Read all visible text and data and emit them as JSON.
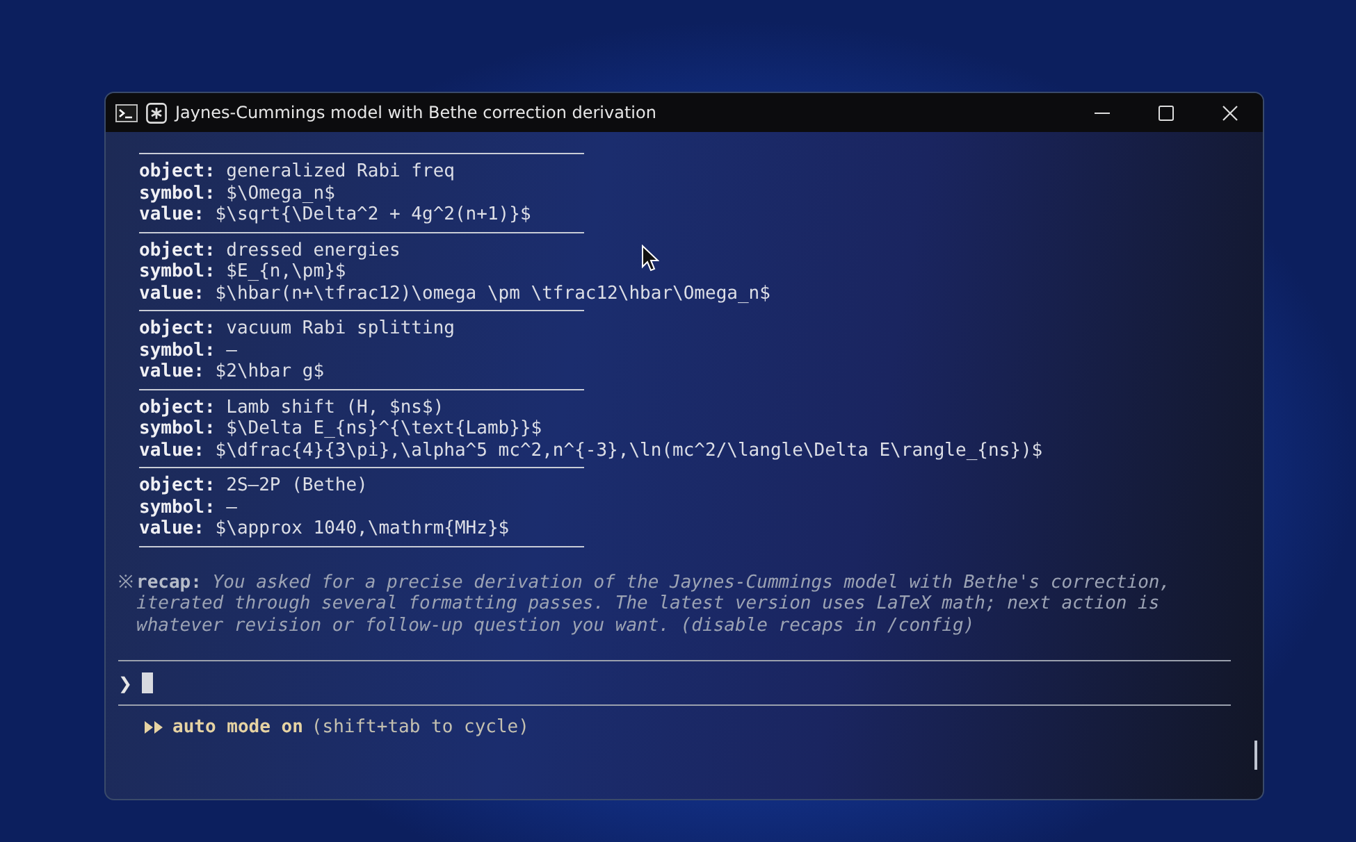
{
  "window": {
    "title": "Jaynes-Cummings model with Bethe correction derivation"
  },
  "entries": [
    {
      "lines": [
        {
          "label": "object:",
          "text": "generalized Rabi freq"
        },
        {
          "label": "symbol:",
          "text": "$\\Omega_n$"
        },
        {
          "label": "value:",
          "text": "$\\sqrt{\\Delta^2 + 4g^2(n+1)}$"
        }
      ]
    },
    {
      "lines": [
        {
          "label": "object:",
          "text": "dressed energies"
        },
        {
          "label": "symbol:",
          "text": "$E_{n,\\pm}$"
        },
        {
          "label": "value:",
          "text": "$\\hbar(n+\\tfrac12)\\omega \\pm \\tfrac12\\hbar\\Omega_n$"
        }
      ]
    },
    {
      "lines": [
        {
          "label": "object:",
          "text": "vacuum Rabi splitting"
        },
        {
          "label": "symbol:",
          "text": "—"
        },
        {
          "label": "value:",
          "text": "$2\\hbar g$"
        }
      ]
    },
    {
      "lines": [
        {
          "label": "object:",
          "text": "Lamb shift (H, $ns$)"
        },
        {
          "label": "symbol:",
          "text": "$\\Delta E_{ns}^{\\text{Lamb}}$"
        },
        {
          "label": "value:",
          "text": "$\\dfrac{4}{3\\pi},\\alpha^5 mc^2,n^{-3},\\ln(mc^2/\\langle\\Delta E\\rangle_{ns})$"
        }
      ]
    },
    {
      "lines": [
        {
          "label": "object:",
          "text": "2S–2P (Bethe)"
        },
        {
          "label": "symbol:",
          "text": "—"
        },
        {
          "label": "value:",
          "text": "$\\approx 1040,\\mathrm{MHz}$"
        }
      ]
    }
  ],
  "recap": {
    "marker": "※",
    "label": "recap:",
    "text": "You asked for a precise derivation of the Jaynes-Cummings model with Bethe's correction, iterated through several formatting passes. The latest version uses LaTeX math; next action is whatever revision or follow-up question you want. (disable recaps in /config)"
  },
  "prompt": {
    "symbol": "❯"
  },
  "mode": {
    "label": "auto mode on",
    "hint": "(shift+tab to cycle)"
  }
}
